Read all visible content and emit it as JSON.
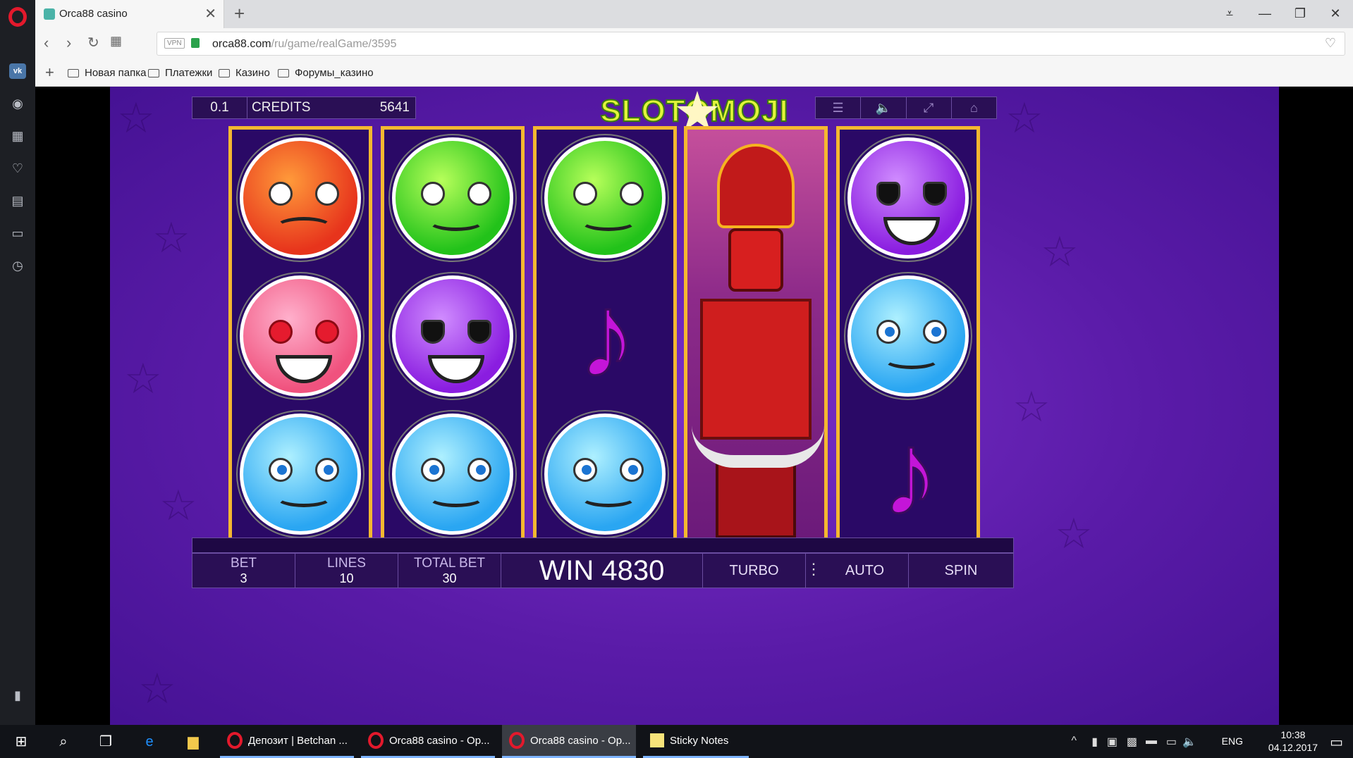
{
  "browser": {
    "tab_title": "Orca88 casino",
    "tab_close": "✕",
    "new_tab": "+",
    "url_host": "orca88.com",
    "url_path": "/ru/game/realGame/3595",
    "vpn": "VPN",
    "bookmarks": [
      "Новая папка",
      "Платежки",
      "Казино",
      "Форумы_казино"
    ]
  },
  "sidebar": {
    "items": [
      "vk-icon",
      "camera-icon",
      "speed-dial-icon",
      "heart-icon",
      "news-icon",
      "sync-icon",
      "history-icon",
      "sidebar-toggle-icon"
    ]
  },
  "game": {
    "denomination": "0.1",
    "credits_label": "CREDITS",
    "credits_value": "5641",
    "logo": "SLOTOMOJI",
    "top_buttons": [
      "menu-icon",
      "sound-icon",
      "fullscreen-icon",
      "home-icon"
    ],
    "reels": [
      [
        "angry",
        "love",
        "sad"
      ],
      [
        "sick",
        "cool",
        "sad"
      ],
      [
        "sick",
        "note",
        "sad"
      ],
      [
        "samurai"
      ],
      [
        "cool",
        "sad",
        "note"
      ]
    ],
    "bet_label": "BET",
    "bet_value": "3",
    "lines_label": "LINES",
    "lines_value": "10",
    "total_bet_label": "TOTAL BET",
    "total_bet_value": "30",
    "win_text": "WIN 4830",
    "turbo": "TURBO",
    "auto": "AUTO",
    "spin": "SPIN",
    "colors": {
      "background": "#5a1ba8",
      "reel_border": "#f5b830",
      "panel": "#2a0f55"
    }
  },
  "taskbar": {
    "apps": [
      {
        "label": "Депозит | Betchan ...",
        "icon": "opera-icon"
      },
      {
        "label": "Orca88 casino - Op...",
        "icon": "opera-icon"
      },
      {
        "label": "Orca88 casino - Op...",
        "icon": "opera-icon"
      },
      {
        "label": "Sticky Notes",
        "icon": "sticky-notes-icon"
      }
    ],
    "lang": "ENG",
    "time": "10:38",
    "date": "04.12.2017"
  }
}
